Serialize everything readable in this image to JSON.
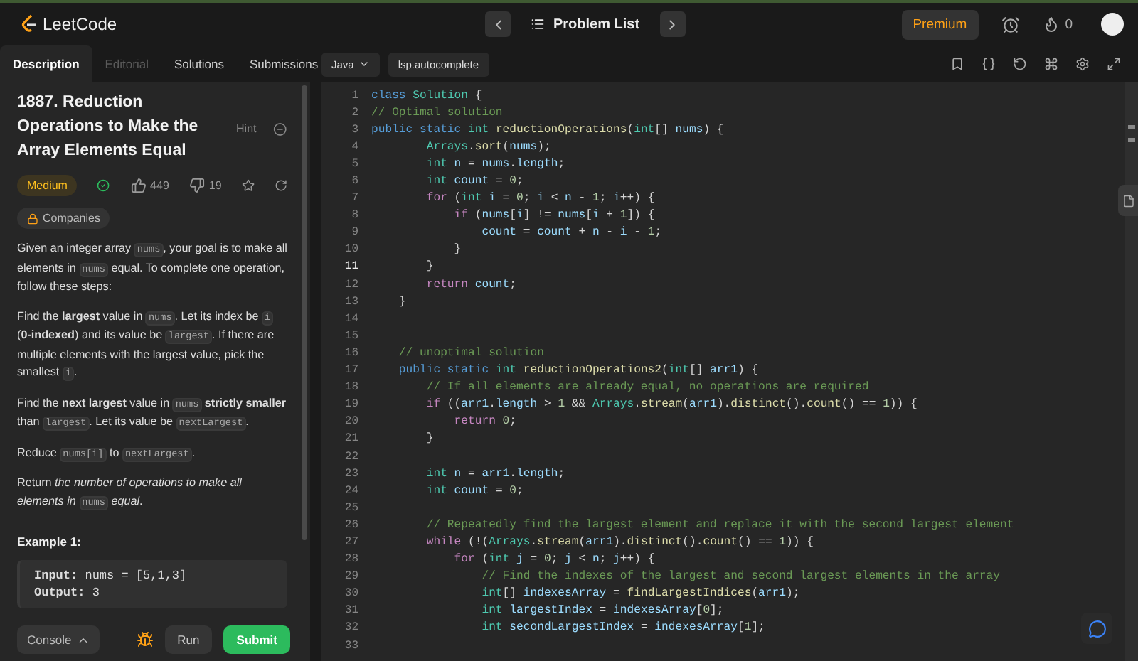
{
  "nav": {
    "logo": "LeetCode",
    "problem_list": "Problem List",
    "premium": "Premium",
    "streak": "0"
  },
  "tabs": [
    {
      "label": "Description",
      "selected": true,
      "disabled": false
    },
    {
      "label": "Editorial",
      "selected": false,
      "disabled": true
    },
    {
      "label": "Solutions",
      "selected": false,
      "disabled": false
    },
    {
      "label": "Submissions",
      "selected": false,
      "disabled": false
    }
  ],
  "problem": {
    "title": "1887. Reduction Operations to Make the Array Elements Equal",
    "hint": "Hint",
    "difficulty": "Medium",
    "solved": true,
    "likes": "449",
    "dislikes": "19",
    "companies": "Companies",
    "paragraphs": [
      [
        {
          "kind": "text",
          "text": "Given an integer array "
        },
        {
          "kind": "code",
          "text": "nums"
        },
        {
          "kind": "text",
          "text": ", your goal is to make all elements in "
        },
        {
          "kind": "code",
          "text": "nums"
        },
        {
          "kind": "text",
          "text": " equal. To complete one operation, follow these steps:"
        }
      ],
      [
        {
          "kind": "text",
          "text": "Find the **largest** value in "
        },
        {
          "kind": "code",
          "text": "nums"
        },
        {
          "kind": "text",
          "text": ". Let its index be "
        },
        {
          "kind": "code",
          "text": "i"
        },
        {
          "kind": "text",
          "text": " (**0-indexed**) and its value be "
        },
        {
          "kind": "code",
          "text": "largest"
        },
        {
          "kind": "text",
          "text": ". If there are multiple elements with the largest value, pick the smallest "
        },
        {
          "kind": "code",
          "text": "i"
        },
        {
          "kind": "text",
          "text": "."
        }
      ],
      [
        {
          "kind": "text",
          "text": "Find the **next largest** value in "
        },
        {
          "kind": "code",
          "text": "nums"
        },
        {
          "kind": "text",
          "text": " **strictly smaller** than "
        },
        {
          "kind": "code",
          "text": "largest"
        },
        {
          "kind": "text",
          "text": ". Let its value be "
        },
        {
          "kind": "code",
          "text": "nextLargest"
        },
        {
          "kind": "text",
          "text": "."
        }
      ],
      [
        {
          "kind": "text",
          "text": "Reduce "
        },
        {
          "kind": "code",
          "text": "nums[i]"
        },
        {
          "kind": "text",
          "text": " to "
        },
        {
          "kind": "code",
          "text": "nextLargest"
        },
        {
          "kind": "text",
          "text": "."
        }
      ],
      [
        {
          "kind": "text",
          "text": "Return *the number of operations to make all elements in* "
        },
        {
          "kind": "code",
          "text": "nums"
        },
        {
          "kind": "text",
          "text": " *equal*."
        }
      ]
    ],
    "example": {
      "heading": "Example 1:",
      "lines": [
        {
          "label": "Input:",
          "value": "nums = [5,1,3]"
        },
        {
          "label": "Output:",
          "value": "3"
        }
      ]
    }
  },
  "actions": {
    "console": "Console",
    "run": "Run",
    "submit": "Submit"
  },
  "editor": {
    "language": "Java",
    "autocomplete": "lsp.autocomplete",
    "lines": [
      {
        "number": "1",
        "active": false,
        "tokens": [
          {
            "kind": "keyword",
            "text": "class "
          },
          {
            "kind": "type",
            "text": "Solution"
          },
          {
            "kind": "plain",
            "text": " {"
          }
        ]
      },
      {
        "number": "2",
        "active": false,
        "tokens": [
          {
            "kind": "comment",
            "text": "// Optimal solution"
          }
        ]
      },
      {
        "number": "3",
        "active": false,
        "tokens": [
          {
            "kind": "keyword",
            "text": "public static "
          },
          {
            "kind": "type",
            "text": "int "
          },
          {
            "kind": "function",
            "text": "reductionOperations"
          },
          {
            "kind": "plain",
            "text": "("
          },
          {
            "kind": "type",
            "text": "int"
          },
          {
            "kind": "plain",
            "text": "[] "
          },
          {
            "kind": "variable",
            "text": "nums"
          },
          {
            "kind": "plain",
            "text": ") {"
          }
        ]
      },
      {
        "number": "4",
        "active": false,
        "tokens": [
          {
            "kind": "type",
            "text": "        Arrays"
          },
          {
            "kind": "plain",
            "text": "."
          },
          {
            "kind": "function",
            "text": "sort"
          },
          {
            "kind": "plain",
            "text": "("
          },
          {
            "kind": "variable",
            "text": "nums"
          },
          {
            "kind": "plain",
            "text": ");"
          }
        ]
      },
      {
        "number": "5",
        "active": false,
        "tokens": [
          {
            "kind": "type",
            "text": "        int "
          },
          {
            "kind": "variable",
            "text": "n"
          },
          {
            "kind": "plain",
            "text": " = "
          },
          {
            "kind": "variable",
            "text": "nums"
          },
          {
            "kind": "plain",
            "text": "."
          },
          {
            "kind": "variable",
            "text": "length"
          },
          {
            "kind": "plain",
            "text": ";"
          }
        ]
      },
      {
        "number": "6",
        "active": false,
        "tokens": [
          {
            "kind": "type",
            "text": "        int "
          },
          {
            "kind": "variable",
            "text": "count"
          },
          {
            "kind": "plain",
            "text": " = "
          },
          {
            "kind": "number",
            "text": "0"
          },
          {
            "kind": "plain",
            "text": ";"
          }
        ]
      },
      {
        "number": "7",
        "active": false,
        "tokens": [
          {
            "kind": "control",
            "text": "        for"
          },
          {
            "kind": "plain",
            "text": " ("
          },
          {
            "kind": "type",
            "text": "int "
          },
          {
            "kind": "variable",
            "text": "i"
          },
          {
            "kind": "plain",
            "text": " = "
          },
          {
            "kind": "number",
            "text": "0"
          },
          {
            "kind": "plain",
            "text": "; "
          },
          {
            "kind": "variable",
            "text": "i"
          },
          {
            "kind": "plain",
            "text": " < "
          },
          {
            "kind": "variable",
            "text": "n"
          },
          {
            "kind": "plain",
            "text": " - "
          },
          {
            "kind": "number",
            "text": "1"
          },
          {
            "kind": "plain",
            "text": "; "
          },
          {
            "kind": "variable",
            "text": "i"
          },
          {
            "kind": "plain",
            "text": "++) {"
          }
        ]
      },
      {
        "number": "8",
        "active": false,
        "tokens": [
          {
            "kind": "control",
            "text": "            if"
          },
          {
            "kind": "plain",
            "text": " ("
          },
          {
            "kind": "variable",
            "text": "nums"
          },
          {
            "kind": "plain",
            "text": "["
          },
          {
            "kind": "variable",
            "text": "i"
          },
          {
            "kind": "plain",
            "text": "] != "
          },
          {
            "kind": "variable",
            "text": "nums"
          },
          {
            "kind": "plain",
            "text": "["
          },
          {
            "kind": "variable",
            "text": "i"
          },
          {
            "kind": "plain",
            "text": " + "
          },
          {
            "kind": "number",
            "text": "1"
          },
          {
            "kind": "plain",
            "text": "]) {"
          }
        ]
      },
      {
        "number": "9",
        "active": false,
        "tokens": [
          {
            "kind": "variable",
            "text": "                count"
          },
          {
            "kind": "plain",
            "text": " = "
          },
          {
            "kind": "variable",
            "text": "count"
          },
          {
            "kind": "plain",
            "text": " + "
          },
          {
            "kind": "variable",
            "text": "n"
          },
          {
            "kind": "plain",
            "text": " - "
          },
          {
            "kind": "variable",
            "text": "i"
          },
          {
            "kind": "plain",
            "text": " - "
          },
          {
            "kind": "number",
            "text": "1"
          },
          {
            "kind": "plain",
            "text": ";"
          }
        ]
      },
      {
        "number": "10",
        "active": false,
        "tokens": [
          {
            "kind": "plain",
            "text": "            }"
          }
        ]
      },
      {
        "number": "11",
        "active": true,
        "tokens": [
          {
            "kind": "plain",
            "text": "        }"
          }
        ]
      },
      {
        "number": "12",
        "active": false,
        "tokens": [
          {
            "kind": "control",
            "text": "        return "
          },
          {
            "kind": "variable",
            "text": "count"
          },
          {
            "kind": "plain",
            "text": ";"
          }
        ]
      },
      {
        "number": "13",
        "active": false,
        "tokens": [
          {
            "kind": "plain",
            "text": "    }"
          }
        ]
      },
      {
        "number": "14",
        "active": false
      },
      {
        "number": "15",
        "active": false
      },
      {
        "number": "16",
        "active": false,
        "tokens": [
          {
            "kind": "comment",
            "text": "    // unoptimal solution"
          }
        ]
      },
      {
        "number": "17",
        "active": false,
        "tokens": [
          {
            "kind": "keyword",
            "text": "    public static "
          },
          {
            "kind": "type",
            "text": "int "
          },
          {
            "kind": "function",
            "text": "reductionOperations2"
          },
          {
            "kind": "plain",
            "text": "("
          },
          {
            "kind": "type",
            "text": "int"
          },
          {
            "kind": "plain",
            "text": "[] "
          },
          {
            "kind": "variable",
            "text": "arr1"
          },
          {
            "kind": "plain",
            "text": ") {"
          }
        ]
      },
      {
        "number": "18",
        "active": false,
        "tokens": [
          {
            "kind": "comment",
            "text": "        // If all elements are already equal, no operations are required"
          }
        ]
      },
      {
        "number": "19",
        "active": false,
        "tokens": [
          {
            "kind": "control",
            "text": "        if"
          },
          {
            "kind": "plain",
            "text": " (("
          },
          {
            "kind": "variable",
            "text": "arr1"
          },
          {
            "kind": "plain",
            "text": "."
          },
          {
            "kind": "variable",
            "text": "length"
          },
          {
            "kind": "plain",
            "text": " > "
          },
          {
            "kind": "number",
            "text": "1"
          },
          {
            "kind": "plain",
            "text": " && "
          },
          {
            "kind": "type",
            "text": "Arrays"
          },
          {
            "kind": "plain",
            "text": "."
          },
          {
            "kind": "function",
            "text": "stream"
          },
          {
            "kind": "plain",
            "text": "("
          },
          {
            "kind": "variable",
            "text": "arr1"
          },
          {
            "kind": "plain",
            "text": ")."
          },
          {
            "kind": "function",
            "text": "distinct"
          },
          {
            "kind": "plain",
            "text": "()."
          },
          {
            "kind": "function",
            "text": "count"
          },
          {
            "kind": "plain",
            "text": "() == "
          },
          {
            "kind": "number",
            "text": "1"
          },
          {
            "kind": "plain",
            "text": ")) {"
          }
        ]
      },
      {
        "number": "20",
        "active": false,
        "tokens": [
          {
            "kind": "control",
            "text": "            return "
          },
          {
            "kind": "number",
            "text": "0"
          },
          {
            "kind": "plain",
            "text": ";"
          }
        ]
      },
      {
        "number": "21",
        "active": false,
        "tokens": [
          {
            "kind": "plain",
            "text": "        }"
          }
        ]
      },
      {
        "number": "22",
        "active": false
      },
      {
        "number": "23",
        "active": false,
        "tokens": [
          {
            "kind": "type",
            "text": "        int "
          },
          {
            "kind": "variable",
            "text": "n"
          },
          {
            "kind": "plain",
            "text": " = "
          },
          {
            "kind": "variable",
            "text": "arr1"
          },
          {
            "kind": "plain",
            "text": "."
          },
          {
            "kind": "variable",
            "text": "length"
          },
          {
            "kind": "plain",
            "text": ";"
          }
        ]
      },
      {
        "number": "24",
        "active": false,
        "tokens": [
          {
            "kind": "type",
            "text": "        int "
          },
          {
            "kind": "variable",
            "text": "count"
          },
          {
            "kind": "plain",
            "text": " = "
          },
          {
            "kind": "number",
            "text": "0"
          },
          {
            "kind": "plain",
            "text": ";"
          }
        ]
      },
      {
        "number": "25",
        "active": false
      },
      {
        "number": "26",
        "active": false,
        "tokens": [
          {
            "kind": "comment",
            "text": "        // Repeatedly find the largest element and replace it with the second largest element"
          }
        ]
      },
      {
        "number": "27",
        "active": false,
        "tokens": [
          {
            "kind": "control",
            "text": "        while"
          },
          {
            "kind": "plain",
            "text": " (!("
          },
          {
            "kind": "type",
            "text": "Arrays"
          },
          {
            "kind": "plain",
            "text": "."
          },
          {
            "kind": "function",
            "text": "stream"
          },
          {
            "kind": "plain",
            "text": "("
          },
          {
            "kind": "variable",
            "text": "arr1"
          },
          {
            "kind": "plain",
            "text": ")."
          },
          {
            "kind": "function",
            "text": "distinct"
          },
          {
            "kind": "plain",
            "text": "()."
          },
          {
            "kind": "function",
            "text": "count"
          },
          {
            "kind": "plain",
            "text": "() == "
          },
          {
            "kind": "number",
            "text": "1"
          },
          {
            "kind": "plain",
            "text": ")) {"
          }
        ]
      },
      {
        "number": "28",
        "active": false,
        "tokens": [
          {
            "kind": "control",
            "text": "            for"
          },
          {
            "kind": "plain",
            "text": " ("
          },
          {
            "kind": "type",
            "text": "int "
          },
          {
            "kind": "variable",
            "text": "j"
          },
          {
            "kind": "plain",
            "text": " = "
          },
          {
            "kind": "number",
            "text": "0"
          },
          {
            "kind": "plain",
            "text": "; "
          },
          {
            "kind": "variable",
            "text": "j"
          },
          {
            "kind": "plain",
            "text": " < "
          },
          {
            "kind": "variable",
            "text": "n"
          },
          {
            "kind": "plain",
            "text": "; "
          },
          {
            "kind": "variable",
            "text": "j"
          },
          {
            "kind": "plain",
            "text": "++) {"
          }
        ]
      },
      {
        "number": "29",
        "active": false,
        "tokens": [
          {
            "kind": "comment",
            "text": "                // Find the indexes of the largest and second largest elements in the array"
          }
        ]
      },
      {
        "number": "30",
        "active": false,
        "tokens": [
          {
            "kind": "type",
            "text": "                int"
          },
          {
            "kind": "plain",
            "text": "[] "
          },
          {
            "kind": "variable",
            "text": "indexesArray"
          },
          {
            "kind": "plain",
            "text": " = "
          },
          {
            "kind": "function",
            "text": "findLargestIndices"
          },
          {
            "kind": "plain",
            "text": "("
          },
          {
            "kind": "variable",
            "text": "arr1"
          },
          {
            "kind": "plain",
            "text": ");"
          }
        ]
      },
      {
        "number": "31",
        "active": false,
        "tokens": [
          {
            "kind": "type",
            "text": "                int "
          },
          {
            "kind": "variable",
            "text": "largestIndex"
          },
          {
            "kind": "plain",
            "text": " = "
          },
          {
            "kind": "variable",
            "text": "indexesArray"
          },
          {
            "kind": "plain",
            "text": "["
          },
          {
            "kind": "number",
            "text": "0"
          },
          {
            "kind": "plain",
            "text": "];"
          }
        ]
      },
      {
        "number": "32",
        "active": false,
        "tokens": [
          {
            "kind": "type",
            "text": "                int "
          },
          {
            "kind": "variable",
            "text": "secondLargestIndex"
          },
          {
            "kind": "plain",
            "text": " = "
          },
          {
            "kind": "variable",
            "text": "indexesArray"
          },
          {
            "kind": "plain",
            "text": "["
          },
          {
            "kind": "number",
            "text": "1"
          },
          {
            "kind": "plain",
            "text": "];"
          }
        ]
      },
      {
        "number": "33",
        "active": false
      }
    ]
  }
}
